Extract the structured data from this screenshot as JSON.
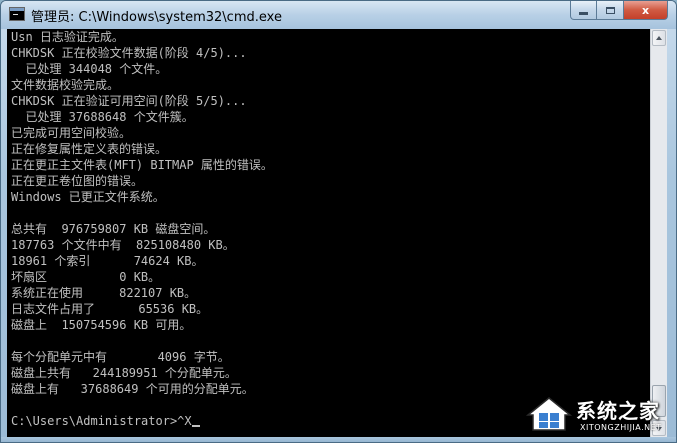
{
  "window": {
    "title": "管理员: C:\\Windows\\system32\\cmd.exe",
    "close_glyph": "x"
  },
  "console": {
    "lines": [
      "Usn 日志验证完成。",
      "CHKDSK 正在校验文件数据(阶段 4/5)...",
      "  已处理 344048 个文件。",
      "文件数据校验完成。",
      "CHKDSK 正在验证可用空间(阶段 5/5)...",
      "  已处理 37688648 个文件簇。",
      "已完成可用空间校验。",
      "正在修复属性定义表的错误。",
      "正在更正主文件表(MFT) BITMAP 属性的错误。",
      "正在更正卷位图的错误。",
      "Windows 已更正文件系统。",
      "",
      "总共有  976759807 KB 磁盘空间。",
      "187763 个文件中有  825108480 KB。",
      "18961 个索引      74624 KB。",
      "坏扇区          0 KB。",
      "系统正在使用     822107 KB。",
      "日志文件占用了      65536 KB。",
      "磁盘上  150754596 KB 可用。",
      "",
      "每个分配单元中有       4096 字节。",
      "磁盘上共有   244189951 个分配单元。",
      "磁盘上有   37688649 个可用的分配单元。",
      "",
      "C:\\Users\\Administrator>^X"
    ]
  },
  "watermark": {
    "text": "系统之家",
    "sub": "XITONGZHIJIA.NET"
  },
  "colors": {
    "console_bg": "#000000",
    "console_fg": "#c0c0c0",
    "close_button": "#c4402a"
  },
  "icons": {
    "title": "cmd-icon",
    "minimize": "minimize-icon",
    "maximize": "maximize-icon",
    "close": "close-icon",
    "scroll_up": "arrow-up-icon",
    "scroll_down": "arrow-down-icon",
    "watermark_logo": "house-logo-icon"
  }
}
